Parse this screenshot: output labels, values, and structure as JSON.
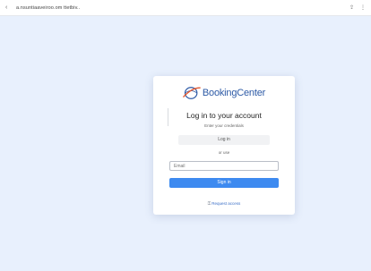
{
  "browser": {
    "url": "a.nsuntiaaveiroo.om ttetbiv..",
    "back_icon": "back-arrow-icon",
    "icons": [
      "share-icon",
      "menu-icon"
    ]
  },
  "login_card": {
    "brand": "BookingCenter",
    "heading": "Log in to your account",
    "subheading": "Enter your credentials",
    "sso_label": "Log in",
    "or_label": "or use",
    "email_placeholder": "Email",
    "submit_label": "Sign in",
    "footer_link": "Request access"
  },
  "colors": {
    "page_background": "#e8f0fd",
    "brand": "#2d5aa6",
    "accent_button": "#3d8af0",
    "logo_accent": "#e4572e"
  }
}
